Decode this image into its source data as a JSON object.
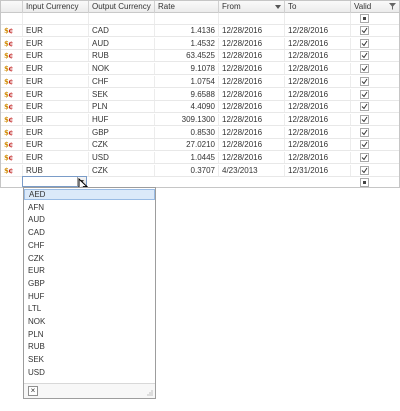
{
  "columns": {
    "input_currency": "Input Currency",
    "output_currency": "Output Currency",
    "rate": "Rate",
    "from": "From",
    "to": "To",
    "valid": "Valid"
  },
  "row_icon": "currency-exchange-icon",
  "rows": [
    {
      "in": "EUR",
      "out": "CAD",
      "rate": "1.4136",
      "from": "12/28/2016",
      "to": "12/28/2016",
      "valid": true
    },
    {
      "in": "EUR",
      "out": "AUD",
      "rate": "1.4532",
      "from": "12/28/2016",
      "to": "12/28/2016",
      "valid": true
    },
    {
      "in": "EUR",
      "out": "RUB",
      "rate": "63.4525",
      "from": "12/28/2016",
      "to": "12/28/2016",
      "valid": true
    },
    {
      "in": "EUR",
      "out": "NOK",
      "rate": "9.1078",
      "from": "12/28/2016",
      "to": "12/28/2016",
      "valid": true
    },
    {
      "in": "EUR",
      "out": "CHF",
      "rate": "1.0754",
      "from": "12/28/2016",
      "to": "12/28/2016",
      "valid": true
    },
    {
      "in": "EUR",
      "out": "SEK",
      "rate": "9.6588",
      "from": "12/28/2016",
      "to": "12/28/2016",
      "valid": true
    },
    {
      "in": "EUR",
      "out": "PLN",
      "rate": "4.4090",
      "from": "12/28/2016",
      "to": "12/28/2016",
      "valid": true
    },
    {
      "in": "EUR",
      "out": "HUF",
      "rate": "309.1300",
      "from": "12/28/2016",
      "to": "12/28/2016",
      "valid": true
    },
    {
      "in": "EUR",
      "out": "GBP",
      "rate": "0.8530",
      "from": "12/28/2016",
      "to": "12/28/2016",
      "valid": true
    },
    {
      "in": "EUR",
      "out": "CZK",
      "rate": "27.0210",
      "from": "12/28/2016",
      "to": "12/28/2016",
      "valid": true
    },
    {
      "in": "EUR",
      "out": "USD",
      "rate": "1.0445",
      "from": "12/28/2016",
      "to": "12/28/2016",
      "valid": true
    },
    {
      "in": "RUB",
      "out": "CZK",
      "rate": "0.3707",
      "from": "4/23/2013",
      "to": "12/31/2016",
      "valid": true
    }
  ],
  "new_row": {
    "in": ""
  },
  "dropdown": {
    "options": [
      "AED",
      "AFN",
      "AUD",
      "CAD",
      "CHF",
      "CZK",
      "EUR",
      "GBP",
      "HUF",
      "LTL",
      "NOK",
      "PLN",
      "RUB",
      "SEK",
      "USD"
    ],
    "selected": "AED",
    "close_icon": "close-icon"
  },
  "colors": {
    "selection": "#dbe9f9",
    "selection_border": "#99bbe4",
    "icon_dollar": "#d08a00",
    "icon_cent": "#c02020"
  }
}
